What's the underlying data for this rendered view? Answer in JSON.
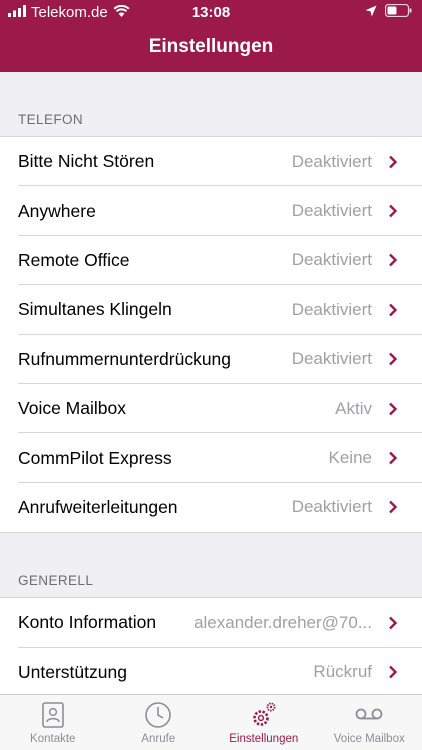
{
  "status_bar": {
    "carrier": "Telekom.de",
    "time": "13:08"
  },
  "header": {
    "title": "Einstellungen"
  },
  "sections": [
    {
      "title": "TELEFON",
      "rows": [
        {
          "label": "Bitte Nicht Stören",
          "value": "Deaktiviert"
        },
        {
          "label": "Anywhere",
          "value": "Deaktiviert"
        },
        {
          "label": "Remote Office",
          "value": "Deaktiviert"
        },
        {
          "label": "Simultanes Klingeln",
          "value": "Deaktiviert"
        },
        {
          "label": "Rufnummernunterdrückung",
          "value": "Deaktiviert"
        },
        {
          "label": "Voice Mailbox",
          "value": "Aktiv"
        },
        {
          "label": "CommPilot Express",
          "value": "Keine"
        },
        {
          "label": "Anrufweiterleitungen",
          "value": "Deaktiviert"
        }
      ]
    },
    {
      "title": "GENERELL",
      "rows": [
        {
          "label": "Konto Information",
          "value": "alexander.dreher@70..."
        },
        {
          "label": "Unterstützung",
          "value": "Rückruf"
        }
      ]
    }
  ],
  "tabs": [
    {
      "label": "Kontakte",
      "icon": "contacts-icon"
    },
    {
      "label": "Anrufe",
      "icon": "clock-icon"
    },
    {
      "label": "Einstellungen",
      "icon": "gear-icon",
      "active": true
    },
    {
      "label": "Voice Mailbox",
      "icon": "voicemail-icon"
    }
  ],
  "colors": {
    "brand": "#9c1a4a",
    "value_text": "#a0a0a6",
    "background": "#efeff4"
  }
}
